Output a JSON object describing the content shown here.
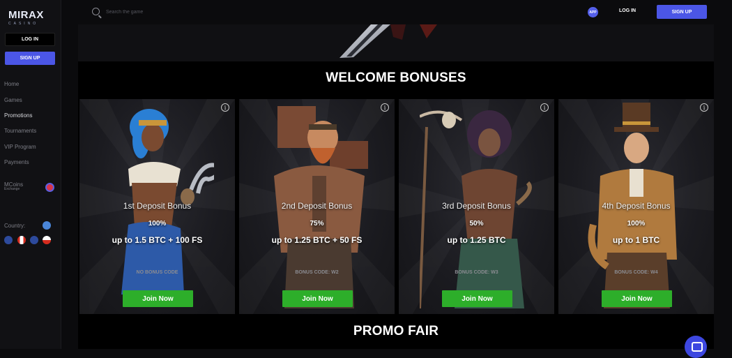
{
  "brand": {
    "logo_text": "MIRAX",
    "logo_sub": "CASINO"
  },
  "sidebar": {
    "login_label": "LOG IN",
    "signup_label": "SIGN UP",
    "items": [
      {
        "label": "Home"
      },
      {
        "label": "Games"
      },
      {
        "label": "Promotions"
      },
      {
        "label": "Tournaments"
      },
      {
        "label": "VIP Program"
      },
      {
        "label": "Payments"
      }
    ],
    "mcoins": {
      "label": "MCoins",
      "sub": "Exchange"
    },
    "country_label": "Country:"
  },
  "header": {
    "search_placeholder": "Search the game",
    "app_label": "APP",
    "login_label": "LOG IN",
    "signup_label": "SIGN UP"
  },
  "welcome": {
    "title": "WELCOME BONUSES",
    "cards": [
      {
        "title": "1st Deposit Bonus",
        "percent": "100%",
        "amount": "up to 1.5 BTC + 100 FS",
        "code": "NO BONUS CODE",
        "button": "Join Now"
      },
      {
        "title": "2nd Deposit Bonus",
        "percent": "75%",
        "amount": "up to 1.25 BTC + 50 FS",
        "code": "BONUS CODE: W2",
        "button": "Join Now"
      },
      {
        "title": "3rd Deposit Bonus",
        "percent": "50%",
        "amount": "up to 1.25 BTC",
        "code": "BONUS CODE: W3",
        "button": "Join Now"
      },
      {
        "title": "4th Deposit Bonus",
        "percent": "100%",
        "amount": "up to 1 BTC",
        "code": "BONUS CODE: W4",
        "button": "Join Now"
      }
    ]
  },
  "promo_fair": {
    "title": "PROMO FAIR"
  },
  "colors": {
    "accent": "#4b56e6",
    "join_button": "#2dae2a",
    "background": "#000000"
  },
  "icons": [
    "search-icon",
    "info-icon",
    "chat-icon"
  ]
}
